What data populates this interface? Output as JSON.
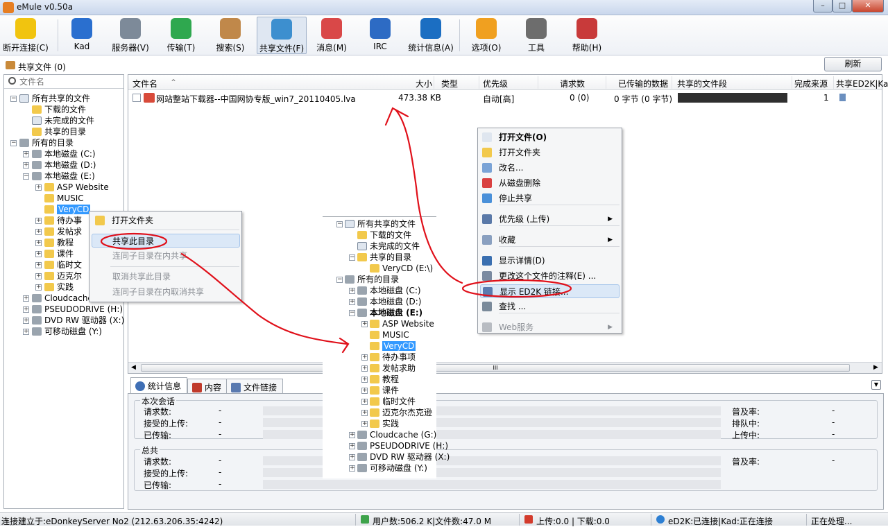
{
  "window": {
    "title": "eMule v0.50a",
    "minimize": "–",
    "maximize": "□",
    "close": "✕"
  },
  "toolbar": [
    {
      "label": "断开连接(C)",
      "color": "#f1c40f"
    },
    {
      "label": "Kad",
      "color": "#2a6fcf"
    },
    {
      "label": "服务器(V)",
      "color": "#7d8a99"
    },
    {
      "label": "传输(T)",
      "color": "#2fa84f"
    },
    {
      "label": "搜索(S)",
      "color": "#c0884a"
    },
    {
      "label": "共享文件(F)",
      "color": "#3d8fcf"
    },
    {
      "label": "消息(M)",
      "color": "#d94848"
    },
    {
      "label": "IRC",
      "color": "#2d6bc4"
    },
    {
      "label": "统计信息(A)",
      "color": "#1b6ec2"
    },
    {
      "label": "选项(O)",
      "color": "#f0a020"
    },
    {
      "label": "工具",
      "color": "#6d6d6d"
    },
    {
      "label": "帮助(H)",
      "color": "#c83a3a"
    }
  ],
  "page": {
    "title": "共享文件 (0)",
    "refresh": "刷新"
  },
  "search": {
    "placeholder": "文件名"
  },
  "tree": [
    {
      "label": "所有共享的文件",
      "icon": "docic",
      "exp": "−"
    },
    {
      "label": "下载的文件",
      "icon": "folder"
    },
    {
      "label": "未完成的文件",
      "icon": "docic"
    },
    {
      "label": "共享的目录",
      "icon": "folder"
    },
    {
      "label": "所有的目录",
      "icon": "drive",
      "exp": "−"
    },
    {
      "label": "本地磁盘 (C:)",
      "icon": "drive",
      "exp": "+"
    },
    {
      "label": "本地磁盘 (D:)",
      "icon": "drive",
      "exp": "+"
    },
    {
      "label": "本地磁盘 (E:)",
      "icon": "drive",
      "exp": "−"
    },
    {
      "label": "ASP Website",
      "icon": "folder",
      "exp": "+"
    },
    {
      "label": "MUSIC",
      "icon": "folder"
    },
    {
      "label": "VeryCD",
      "icon": "folder",
      "sel": true
    },
    {
      "label": "待办事",
      "icon": "folder",
      "exp": "+"
    },
    {
      "label": "发帖求",
      "icon": "folder",
      "exp": "+"
    },
    {
      "label": "教程",
      "icon": "folder",
      "exp": "+"
    },
    {
      "label": "课件",
      "icon": "folder",
      "exp": "+"
    },
    {
      "label": "临时文",
      "icon": "folder",
      "exp": "+"
    },
    {
      "label": "迈克尔",
      "icon": "folder",
      "exp": "+"
    },
    {
      "label": "实践",
      "icon": "folder",
      "exp": "+"
    },
    {
      "label": "Cloudcache",
      "icon": "drive",
      "exp": "+"
    },
    {
      "label": "PSEUDODRIVE (H:)",
      "icon": "drive",
      "exp": "+"
    },
    {
      "label": "DVD RW 驱动器 (X:)",
      "icon": "drive",
      "exp": "+"
    },
    {
      "label": "可移动磁盘 (Y:)",
      "icon": "drive",
      "exp": "+"
    }
  ],
  "columns": [
    "文件名",
    "大小",
    "类型",
    "优先级",
    "请求数",
    "已传输的数据",
    "共享的文件段",
    "完成来源",
    "共享ED2K|Ka"
  ],
  "file": {
    "name": "网站整站下载器--中国网协专版_win7_20110405.lva",
    "size": "473.38 KB",
    "type": "",
    "priority": "自动[高]",
    "requests": "0 (0)",
    "transferred": "0 字节 (0 字节)",
    "complete": "1"
  },
  "hscroll": "III",
  "folder_menu": [
    "打开文件夹",
    "共享此目录",
    "连同子目录在内共享",
    "取消共享此目录",
    "连同子目录在内取消共享"
  ],
  "inset_tree": [
    {
      "label": "所有共享的文件",
      "icon": "docic",
      "exp": "−"
    },
    {
      "label": "下载的文件",
      "icon": "folder"
    },
    {
      "label": "未完成的文件",
      "icon": "docic"
    },
    {
      "label": "共享的目录",
      "icon": "folder",
      "exp": "−"
    },
    {
      "label": "VeryCD  (E:\\)",
      "icon": "folder"
    },
    {
      "label": "所有的目录",
      "icon": "drive",
      "exp": "−"
    },
    {
      "label": "本地磁盘 (C:)",
      "icon": "drive",
      "exp": "+"
    },
    {
      "label": "本地磁盘 (D:)",
      "icon": "drive",
      "exp": "+"
    },
    {
      "label": "本地磁盘 (E:)",
      "icon": "drive",
      "exp": "−",
      "bold": true
    },
    {
      "label": "ASP Website",
      "icon": "folder",
      "exp": "+"
    },
    {
      "label": "MUSIC",
      "icon": "folder"
    },
    {
      "label": "VeryCD",
      "icon": "folder",
      "sel": true
    },
    {
      "label": "待办事项",
      "icon": "folder",
      "exp": "+"
    },
    {
      "label": "发帖求助",
      "icon": "folder",
      "exp": "+"
    },
    {
      "label": "教程",
      "icon": "folder",
      "exp": "+"
    },
    {
      "label": "课件",
      "icon": "folder",
      "exp": "+"
    },
    {
      "label": "临时文件",
      "icon": "folder",
      "exp": "+"
    },
    {
      "label": "迈克尔杰克逊",
      "icon": "folder",
      "exp": "+"
    },
    {
      "label": "实践",
      "icon": "folder",
      "exp": "+"
    },
    {
      "label": "Cloudcache (G:)",
      "icon": "drive",
      "exp": "+"
    },
    {
      "label": "PSEUDODRIVE (H:)",
      "icon": "drive",
      "exp": "+"
    },
    {
      "label": "DVD RW 驱动器 (X:)",
      "icon": "drive",
      "exp": "+"
    },
    {
      "label": "可移动磁盘 (Y:)",
      "icon": "drive",
      "exp": "+"
    }
  ],
  "file_menu": [
    {
      "label": "打开文件(O)",
      "color": "#dfe6ef",
      "bold": true
    },
    {
      "label": "打开文件夹",
      "color": "#f2c94c"
    },
    {
      "label": "改名...",
      "color": "#7aa3d6"
    },
    {
      "label": "从磁盘删除",
      "color": "#d94040"
    },
    {
      "label": "停止共享",
      "color": "#4a90d9"
    },
    {
      "label": "优先级 (上传)",
      "color": "#5a79a8",
      "arrow": "▶"
    },
    {
      "label": "收藏",
      "color": "#8aa0c0",
      "arrow": "▶"
    },
    {
      "label": "显示详情(D)",
      "color": "#3a6fb0"
    },
    {
      "label": "更改这个文件的注释(E) ...",
      "color": "#7a8aa0"
    },
    {
      "label": "显示 ED2K 链接...",
      "color": "#5a7ab0"
    },
    {
      "label": "查找 ...",
      "color": "#7a8a9a"
    },
    {
      "label": "Web服务",
      "color": "#b8bcc2",
      "arrow": "▶"
    }
  ],
  "tabs": [
    "统计信息",
    "内容",
    "文件链接"
  ],
  "stats": {
    "session_title": "本次会话",
    "total_title": "总共",
    "session": [
      [
        "请求数:",
        "-"
      ],
      [
        "接受的上传:",
        "-"
      ],
      [
        "已传输:",
        "-"
      ]
    ],
    "session_right": [
      [
        "普及率:",
        "-"
      ],
      [
        "排队中:",
        "-"
      ],
      [
        "上传中:",
        "-"
      ]
    ],
    "total": [
      [
        "请求数:",
        "-"
      ],
      [
        "接受的上传:",
        "-"
      ],
      [
        "已传输:",
        "-"
      ]
    ],
    "total_right": [
      [
        "普及率:",
        "-"
      ]
    ]
  },
  "statusbar": {
    "connection": "连接建立于:eDonkeyServer No2 (212.63.206.35:4242)",
    "users": "用户数:506.2 K|文件数:47.0 M",
    "speed": "上传:0.0 | 下载:0.0",
    "network": "eD2K:已连接|Kad:正在连接",
    "state": "正在处理..."
  }
}
